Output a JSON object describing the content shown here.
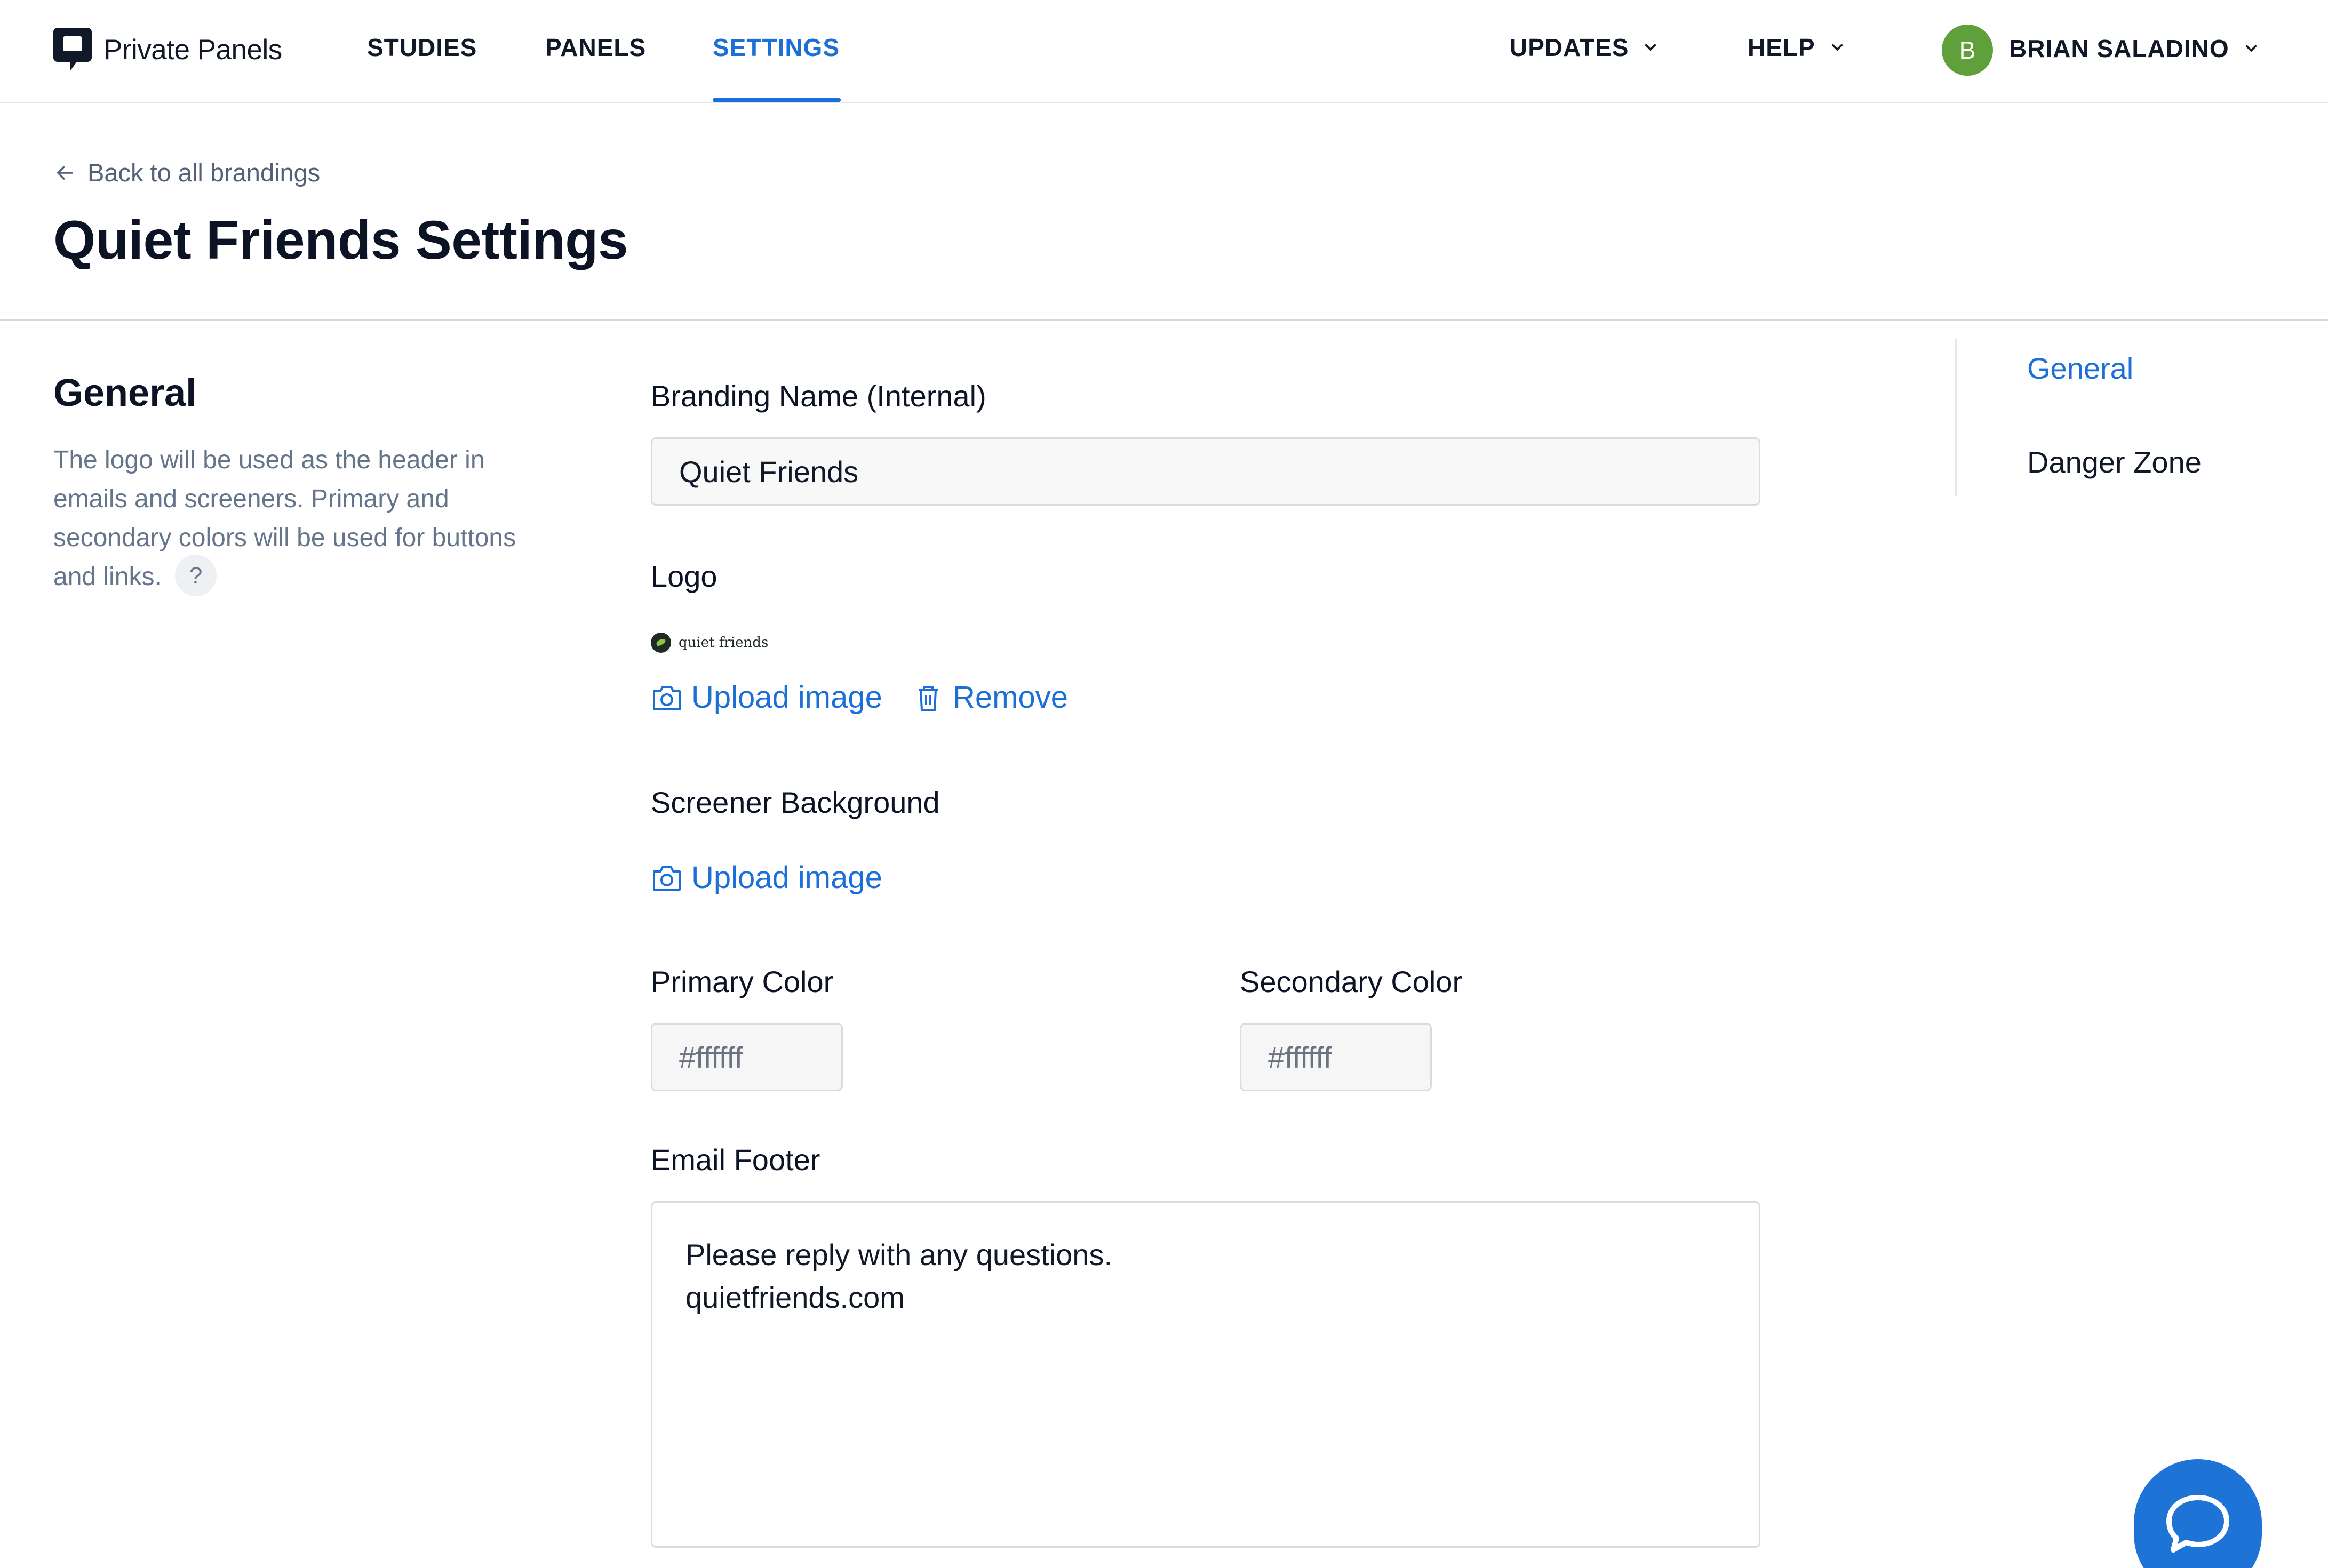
{
  "nav": {
    "brand": "Private Panels",
    "links": [
      "STUDIES",
      "PANELS",
      "SETTINGS"
    ],
    "active_link": "SETTINGS",
    "updates": "UPDATES",
    "help": "HELP",
    "user_initial": "B",
    "user_name": "BRIAN SALADINO"
  },
  "header": {
    "back_label": "Back to all brandings",
    "title": "Quiet Friends Settings"
  },
  "general": {
    "title": "General",
    "description": "The logo will be used as the header in emails and screeners. Primary and secondary colors will be used for buttons and links.",
    "help_icon_text": "?"
  },
  "form": {
    "branding_name_label": "Branding Name (Internal)",
    "branding_name_value": "Quiet Friends",
    "logo_label": "Logo",
    "logo_preview_text": "quiet friends",
    "upload_image_label": "Upload image",
    "remove_label": "Remove",
    "screener_bg_label": "Screener Background",
    "primary_color_label": "Primary Color",
    "primary_color_value": "#ffffff",
    "secondary_color_label": "Secondary Color",
    "secondary_color_value": "#ffffff",
    "email_footer_label": "Email Footer",
    "email_footer_line1": "Please reply with any questions.",
    "email_footer_line2": "quietfriends.com"
  },
  "side_nav": {
    "items": [
      "General",
      "Danger Zone"
    ],
    "active": "General"
  },
  "colors": {
    "accent": "#1d6fd8",
    "avatar": "#5fa03a",
    "chat_button": "#1d74d6"
  }
}
